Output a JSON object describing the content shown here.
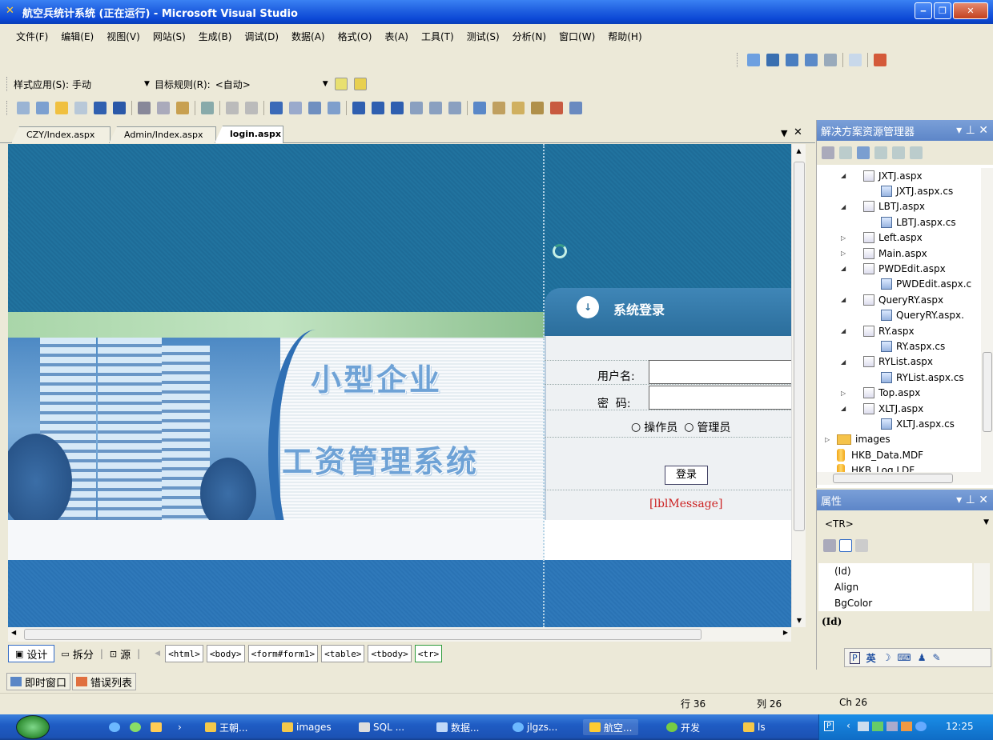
{
  "window": {
    "title": "航空兵统计系统 (正在运行) - Microsoft Visual Studio"
  },
  "menu": [
    "文件(F)",
    "编辑(E)",
    "视图(V)",
    "网站(S)",
    "生成(B)",
    "调试(D)",
    "数据(A)",
    "格式(O)",
    "表(A)",
    "工具(T)",
    "测试(S)",
    "分析(N)",
    "窗口(W)",
    "帮助(H)"
  ],
  "style_toolbar": {
    "style_apply_label": "样式应用(S):",
    "style_apply_value": "手动",
    "target_rule_label": "目标规则(R):",
    "target_rule_value": "<自动>"
  },
  "doc_tabs": [
    "CZY/Index.aspx",
    "Admin/Index.aspx",
    "login.aspx"
  ],
  "login_page": {
    "heading": "系统登录",
    "title_line1": "小型企业",
    "title_line2": "工资管理系统",
    "username_label": "用户名:",
    "password_label": "密  码:",
    "role_operator": "操作员",
    "role_admin": "管理员",
    "login_button": "登录",
    "message_label": "[lblMessage]"
  },
  "view_bar": {
    "design": "设计",
    "split": "拆分",
    "source": "源",
    "tags": [
      "<html>",
      "<body>",
      "<form#form1>",
      "<table>",
      "<tbody>",
      "<tr>"
    ]
  },
  "solution_explorer": {
    "title": "解决方案资源管理器",
    "items": [
      {
        "name": "JXTJ.aspx",
        "kind": "aspx",
        "level": 1
      },
      {
        "name": "JXTJ.aspx.cs",
        "kind": "cs",
        "level": 2
      },
      {
        "name": "LBTJ.aspx",
        "kind": "aspx",
        "level": 1
      },
      {
        "name": "LBTJ.aspx.cs",
        "kind": "cs",
        "level": 2
      },
      {
        "name": "Left.aspx",
        "kind": "aspx",
        "level": 1
      },
      {
        "name": "Main.aspx",
        "kind": "aspx",
        "level": 1
      },
      {
        "name": "PWDEdit.aspx",
        "kind": "aspx",
        "level": 1
      },
      {
        "name": "PWDEdit.aspx.c",
        "kind": "cs",
        "level": 2
      },
      {
        "name": "QueryRY.aspx",
        "kind": "aspx",
        "level": 1
      },
      {
        "name": "QueryRY.aspx.",
        "kind": "cs",
        "level": 2
      },
      {
        "name": "RY.aspx",
        "kind": "aspx",
        "level": 1
      },
      {
        "name": "RY.aspx.cs",
        "kind": "cs",
        "level": 2
      },
      {
        "name": "RYList.aspx",
        "kind": "aspx",
        "level": 1
      },
      {
        "name": "RYList.aspx.cs",
        "kind": "cs",
        "level": 2
      },
      {
        "name": "Top.aspx",
        "kind": "aspx",
        "level": 1
      },
      {
        "name": "XLTJ.aspx",
        "kind": "aspx",
        "level": 1
      },
      {
        "name": "XLTJ.aspx.cs",
        "kind": "cs",
        "level": 2
      },
      {
        "name": "images",
        "kind": "folder",
        "level": 0
      },
      {
        "name": "HKB_Data.MDF",
        "kind": "db",
        "level": 0
      },
      {
        "name": "HKB_Log.LDF",
        "kind": "db",
        "level": 0
      }
    ]
  },
  "properties": {
    "title": "属性",
    "selected_object": "<TR>",
    "rows": [
      "(Id)",
      "Align",
      "BgColor"
    ],
    "description": "(Id)"
  },
  "bottom_tabs": [
    "即时窗口",
    "错误列表"
  ],
  "status": {
    "line": "行 36",
    "col": "列 26",
    "ch": "Ch 26"
  },
  "ime": {
    "mode": "英"
  },
  "taskbar": {
    "tasks": [
      "王朝...",
      "images",
      "SQL ...",
      "数据...",
      "jlgzs...",
      "航空...",
      "开发",
      "ls"
    ],
    "clock": "12:25"
  },
  "colors": {
    "title_bar": "#1f5fe0",
    "panel_title": "#6e93d0",
    "banner_blue": "#1e6c98",
    "message_red": "#cc2222"
  }
}
